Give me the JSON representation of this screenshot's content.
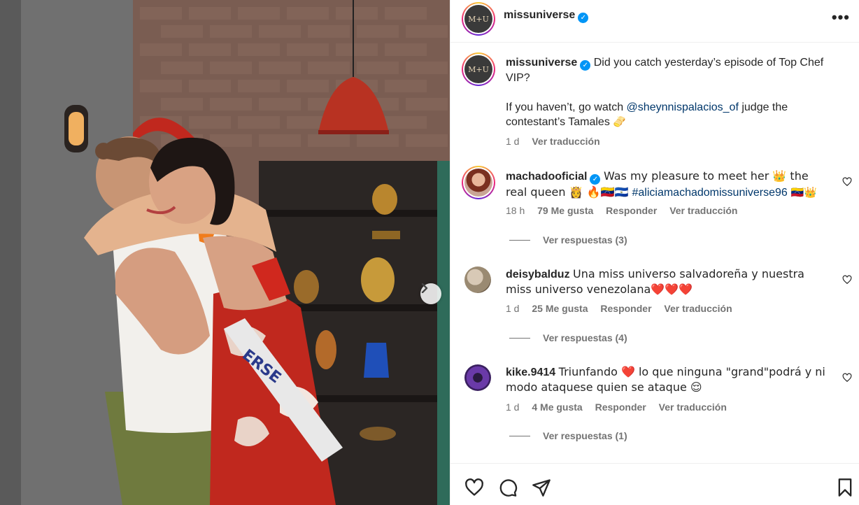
{
  "post": {
    "account": "missuniverse",
    "avatar_text": "M+U",
    "caption_line1": "Did you catch yesterday’s episode of Top Chef VIP?",
    "caption_pre": "If you haven’t, go watch ",
    "caption_mention": "@sheynnispalacios_of",
    "caption_post": " judge the contestant’s Tamales ",
    "caption_emoji": "🫔",
    "time": "1 d",
    "translate": "Ver traducción"
  },
  "comments": [
    {
      "user": "machadooficial",
      "verified": true,
      "text": "Was my pleasure to meet her 👑 the real queen 👸 🔥🇻🇪🇸🇻 ",
      "hashtag": "#aliciamachadomissuniverse96",
      "tail": " 🇻🇪👑",
      "time": "18 h",
      "likes": "79 Me gusta",
      "reply": "Responder",
      "translate": "Ver traducción",
      "view_replies": "Ver respuestas (3)"
    },
    {
      "user": "deisybalduz",
      "verified": false,
      "text": "Una miss universo salvadoreña y nuestra miss universo venezolana❤️❤️❤️",
      "time": "1 d",
      "likes": "25 Me gusta",
      "reply": "Responder",
      "translate": "Ver traducción",
      "view_replies": "Ver respuestas (4)"
    },
    {
      "user": "kike.9414",
      "verified": false,
      "text": "Triunfando ❤️ lo que ninguna \"grand\"podrá y ni modo ataquese quien se ataque 😌",
      "time": "1 d",
      "likes": "4 Me gusta",
      "reply": "Responder",
      "translate": "Ver traducción",
      "view_replies": "Ver respuestas (1)"
    }
  ],
  "icons": {
    "like": "heart-icon",
    "comment": "comment-icon",
    "share": "share-icon",
    "save": "bookmark-icon",
    "more": "more-icon",
    "next": "chevron-right-icon"
  },
  "colors": {
    "verified": "#0095f6",
    "link": "#00376b",
    "muted": "#737373",
    "text": "#262626"
  }
}
